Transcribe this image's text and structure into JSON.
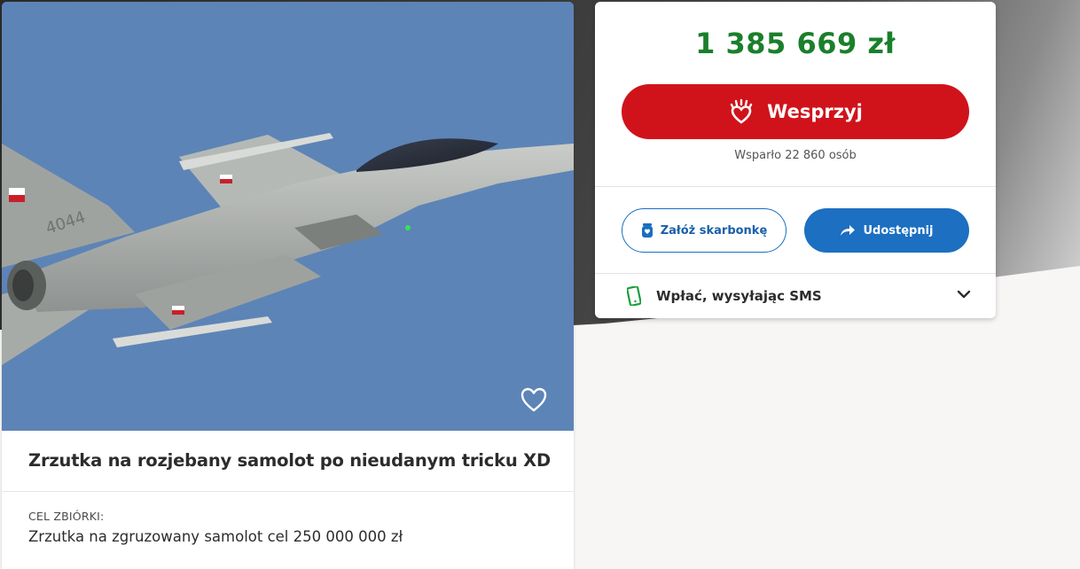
{
  "campaign": {
    "title": "Zrzutka na rozjebany samolot po nieudanym tricku XD",
    "goal_label": "CEL ZBIÓRKI:",
    "goal_text": "Zrzutka na zgruzowany samolot cel 250 000 000 zł",
    "favorite_icon": "heart-outline-icon",
    "aircraft_number": "4044"
  },
  "donation": {
    "amount": "1 385 669 zł",
    "support_label": "Wesprzyj",
    "supporters_text": "Wsparło 22 860 osób",
    "piggybank_label": "Załóż skarbonkę",
    "share_label": "Udostępnij",
    "sms_label": "Wpłać, wysyłając SMS"
  },
  "colors": {
    "amount": "#1a7f2b",
    "support_button": "#d0131b",
    "share_button": "#1c6fc1",
    "sky": "#5d84b6"
  }
}
